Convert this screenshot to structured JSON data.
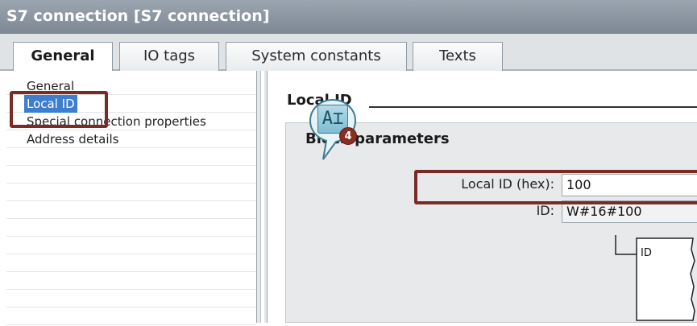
{
  "window": {
    "title": "S7 connection [S7 connection]"
  },
  "tabs": [
    {
      "label": "General",
      "active": true
    },
    {
      "label": "IO tags",
      "active": false
    },
    {
      "label": "System constants",
      "active": false
    },
    {
      "label": "Texts",
      "active": false
    }
  ],
  "nav": {
    "items": [
      {
        "label": "General",
        "selected": false
      },
      {
        "label": "Local ID",
        "selected": true
      },
      {
        "label": "Special connection properties",
        "selected": false
      },
      {
        "label": "Address details",
        "selected": false
      }
    ]
  },
  "content": {
    "section_title": "Local ID",
    "group_title": "Block parameters",
    "local_id_label": "Local ID (hex):",
    "local_id_value": "100",
    "id_label": "ID:",
    "id_value": "W#16#100",
    "diagram_pin": "ID"
  },
  "callout": {
    "icon": "text-cursor-icon",
    "glyph": "A⌶",
    "step": "4"
  },
  "colors": {
    "highlight": "#7a2b23",
    "selection": "#3d7ed0",
    "title_bar": "#8a939d",
    "badge": "#8a2d22"
  }
}
